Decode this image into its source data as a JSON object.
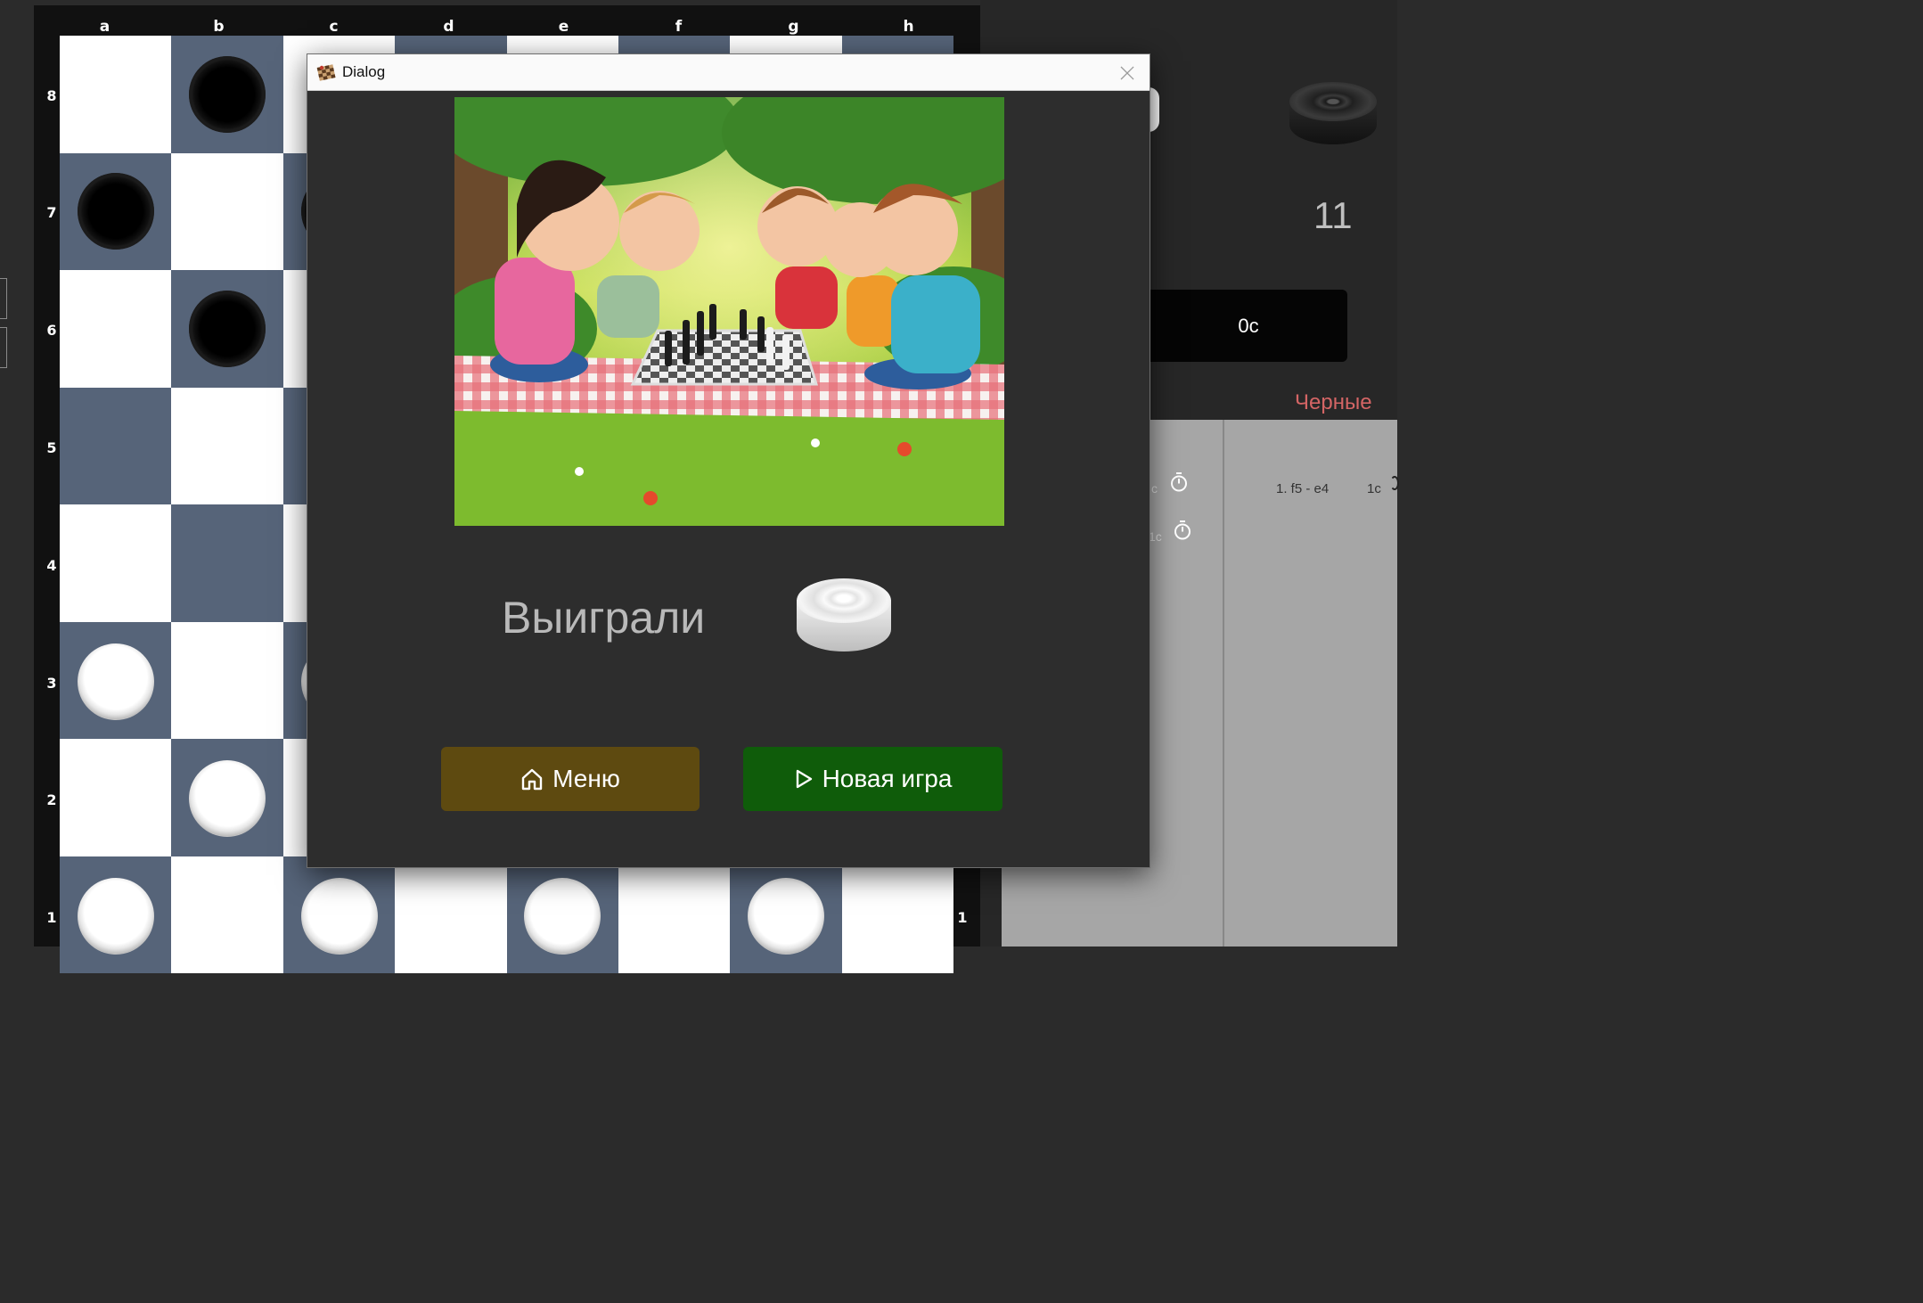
{
  "board": {
    "files": [
      "a",
      "b",
      "c",
      "d",
      "e",
      "f",
      "g",
      "h"
    ],
    "ranks": [
      "8",
      "7",
      "6",
      "5",
      "4",
      "3",
      "2",
      "1"
    ],
    "right_rank_label": "1"
  },
  "side_panel": {
    "piece_count": "11",
    "timer": "0с",
    "player_label": "Черные",
    "moves": {
      "left_fragment_1": "с",
      "left_fragment_2": "1с",
      "move_1": "1. f5 - e4",
      "move_1_time": "1с"
    }
  },
  "dialog": {
    "title": "Dialog",
    "result_text": "Выиграли",
    "menu_button": "Меню",
    "new_game_button": "Новая игра"
  },
  "colors": {
    "board_dark": "#566479",
    "board_light": "#ffffff",
    "menu_button": "#5e4a10",
    "new_game_button": "#0f5c0a",
    "player_label": "#d46565"
  }
}
